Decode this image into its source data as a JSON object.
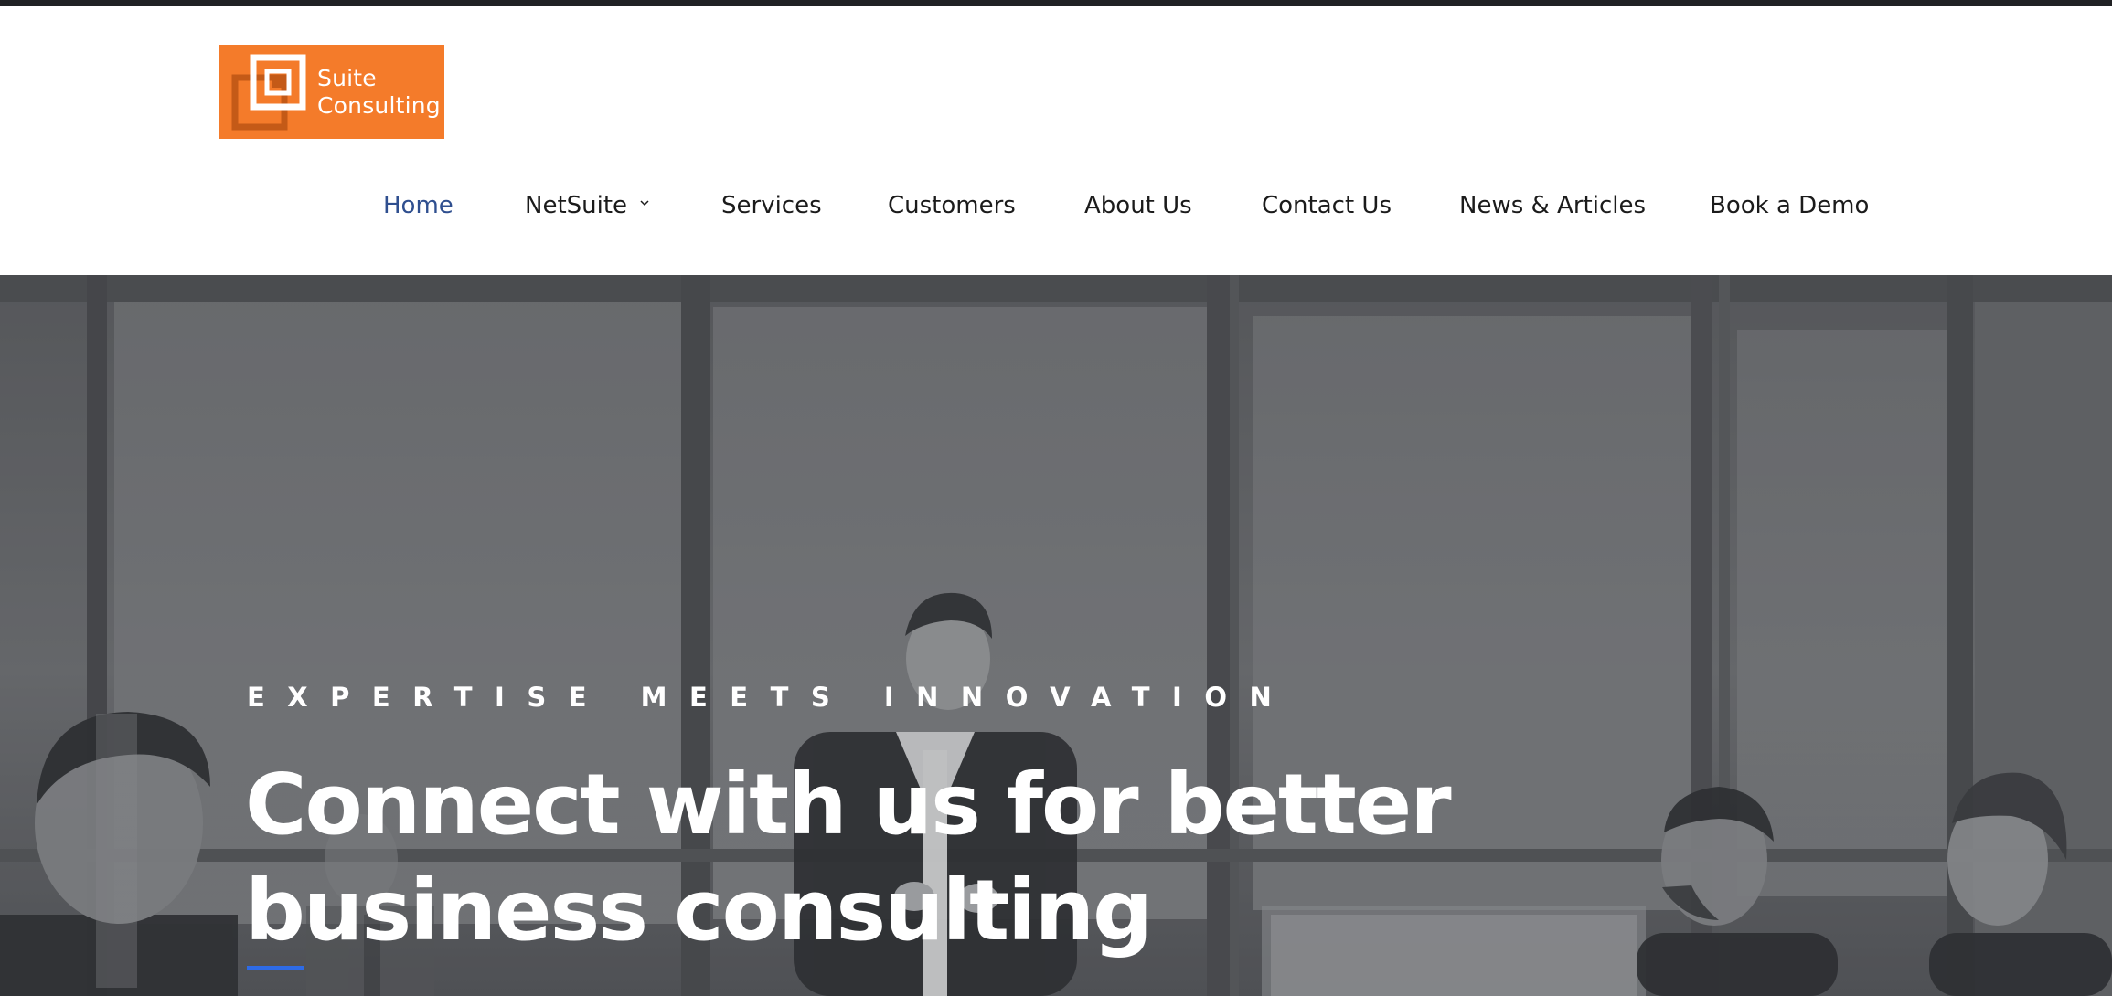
{
  "logo": {
    "line1": "Suite",
    "line2": "Consulting",
    "background_color": "#f47b2a",
    "icon": "nested-squares-logo-icon"
  },
  "nav": {
    "items": [
      {
        "label": "Home",
        "active": true
      },
      {
        "label": "NetSuite",
        "has_dropdown": true
      },
      {
        "label": "Services"
      },
      {
        "label": "Customers"
      },
      {
        "label": "About Us"
      },
      {
        "label": "Contact Us"
      },
      {
        "label": "News & Articles"
      },
      {
        "label": "Book a Demo"
      }
    ],
    "active_color": "#2f4f8f",
    "text_color": "#1b1b1b",
    "dropdown_icon": "chevron-down-icon"
  },
  "hero": {
    "eyebrow": "EXPERTISE MEETS INNOVATION",
    "headline_line1": "Connect with us for better",
    "headline_line2": "business consulting",
    "accent_color": "#2e6be6",
    "background": "grayscale photo of a business meeting in an office with large windows"
  }
}
